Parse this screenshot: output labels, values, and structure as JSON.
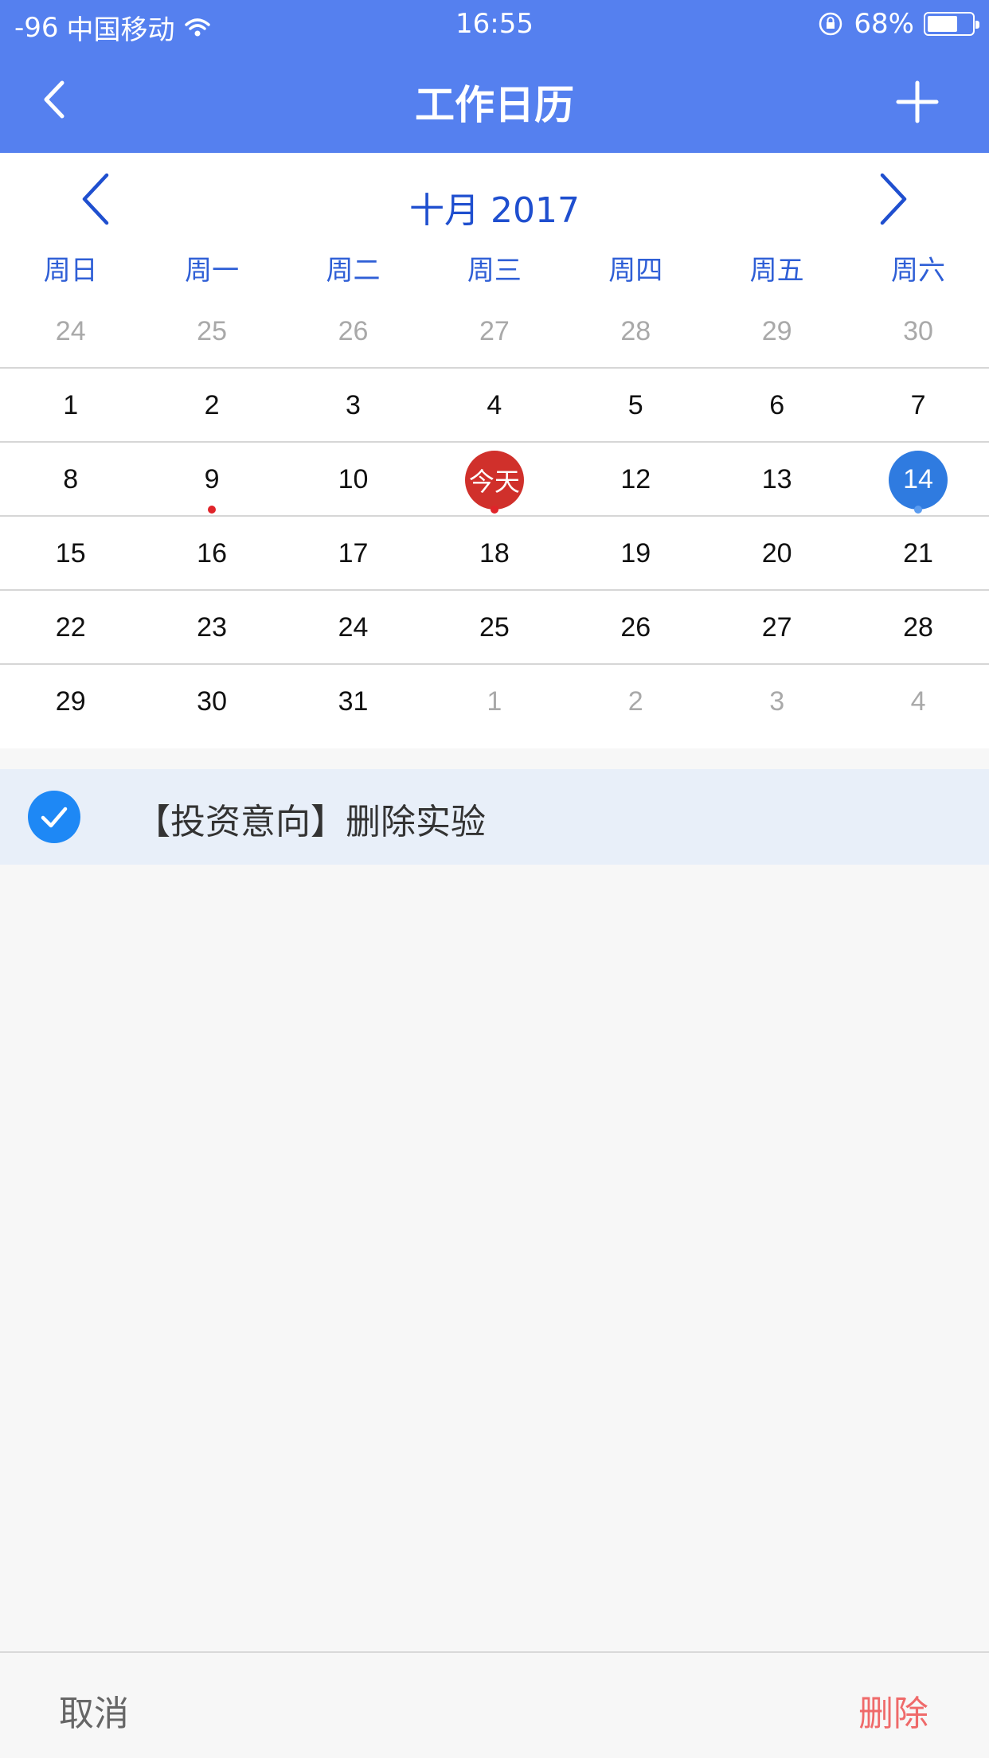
{
  "status_bar": {
    "signal": "-96",
    "carrier": "中国移动",
    "time": "16:55",
    "battery_text": "68%",
    "battery_level": 0.68
  },
  "nav": {
    "title": "工作日历"
  },
  "calendar": {
    "month_title": "十月 2017",
    "weekdays": [
      "周日",
      "周一",
      "周二",
      "周三",
      "周四",
      "周五",
      "周六"
    ],
    "weeks": [
      [
        {
          "d": "24",
          "other": true
        },
        {
          "d": "25",
          "other": true
        },
        {
          "d": "26",
          "other": true
        },
        {
          "d": "27",
          "other": true
        },
        {
          "d": "28",
          "other": true
        },
        {
          "d": "29",
          "other": true
        },
        {
          "d": "30",
          "other": true
        }
      ],
      [
        {
          "d": "1"
        },
        {
          "d": "2"
        },
        {
          "d": "3"
        },
        {
          "d": "4"
        },
        {
          "d": "5"
        },
        {
          "d": "6"
        },
        {
          "d": "7"
        }
      ],
      [
        {
          "d": "8"
        },
        {
          "d": "9",
          "dot": "red"
        },
        {
          "d": "10"
        },
        {
          "d": "今天",
          "today": true,
          "dot": "red"
        },
        {
          "d": "12"
        },
        {
          "d": "13"
        },
        {
          "d": "14",
          "selected": true,
          "dot": "blue"
        }
      ],
      [
        {
          "d": "15"
        },
        {
          "d": "16"
        },
        {
          "d": "17"
        },
        {
          "d": "18"
        },
        {
          "d": "19"
        },
        {
          "d": "20"
        },
        {
          "d": "21"
        }
      ],
      [
        {
          "d": "22"
        },
        {
          "d": "23"
        },
        {
          "d": "24"
        },
        {
          "d": "25"
        },
        {
          "d": "26"
        },
        {
          "d": "27"
        },
        {
          "d": "28"
        }
      ],
      [
        {
          "d": "29"
        },
        {
          "d": "30"
        },
        {
          "d": "31"
        },
        {
          "d": "1",
          "other": true
        },
        {
          "d": "2",
          "other": true
        },
        {
          "d": "3",
          "other": true
        },
        {
          "d": "4",
          "other": true
        }
      ]
    ]
  },
  "event": {
    "text": "【投资意向】删除实验",
    "checked": true
  },
  "bottom": {
    "cancel_label": "取消",
    "delete_label": "删除"
  },
  "colors": {
    "accent": "#5580ef",
    "today": "#d0302b",
    "selected": "#2f7be0",
    "delete": "#ef6a6a"
  }
}
